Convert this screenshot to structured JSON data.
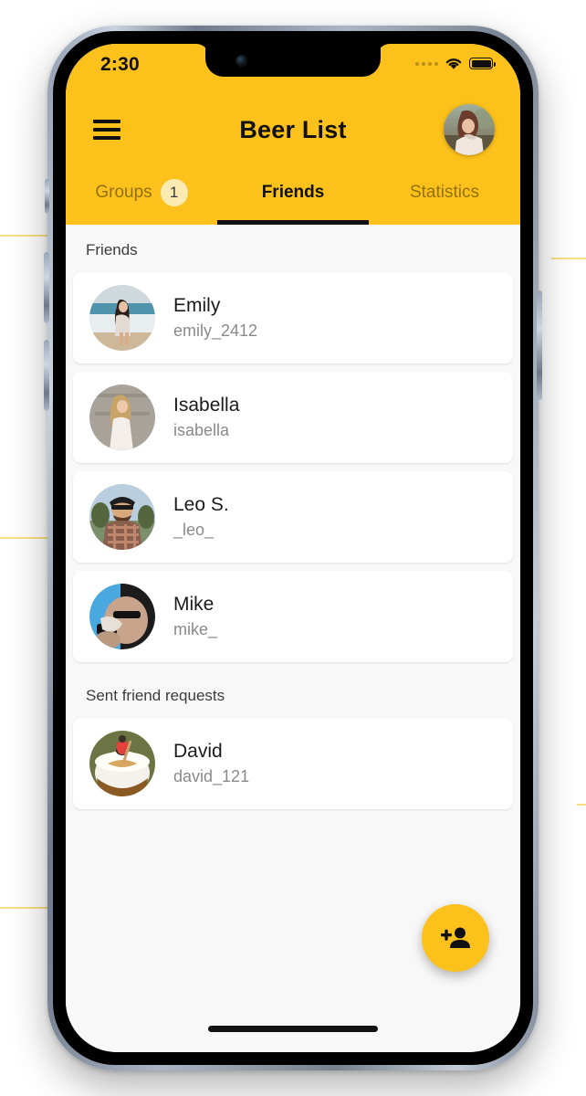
{
  "status_bar": {
    "time": "2:30",
    "signal_icon": "signal-dots-icon",
    "wifi_icon": "wifi-icon",
    "battery_icon": "battery-full-icon"
  },
  "app_bar": {
    "menu_icon": "hamburger-menu-icon",
    "title": "Beer List",
    "avatar_icon": "profile-avatar"
  },
  "tabs": [
    {
      "label": "Groups",
      "badge": "1",
      "active": false
    },
    {
      "label": "Friends",
      "badge": null,
      "active": true
    },
    {
      "label": "Statistics",
      "badge": null,
      "active": false
    }
  ],
  "sections": [
    {
      "header": "Friends",
      "items": [
        {
          "name": "Emily",
          "handle": "emily_2412"
        },
        {
          "name": "Isabella",
          "handle": "isabella"
        },
        {
          "name": "Leo S.",
          "handle": "_leo_"
        },
        {
          "name": "Mike",
          "handle": "mike_"
        }
      ]
    },
    {
      "header": "Sent friend requests",
      "items": [
        {
          "name": "David",
          "handle": "david_121"
        }
      ]
    }
  ],
  "fab": {
    "icon": "person-add-icon",
    "label": "Add friend"
  },
  "colors": {
    "accent": "#FCC11A",
    "badge_bg": "#FBEBB2",
    "card_bg": "#FFFFFF",
    "page_bg": "#F8F8F8",
    "text_primary": "#1B1B1B",
    "text_secondary": "#8A8A8A"
  }
}
